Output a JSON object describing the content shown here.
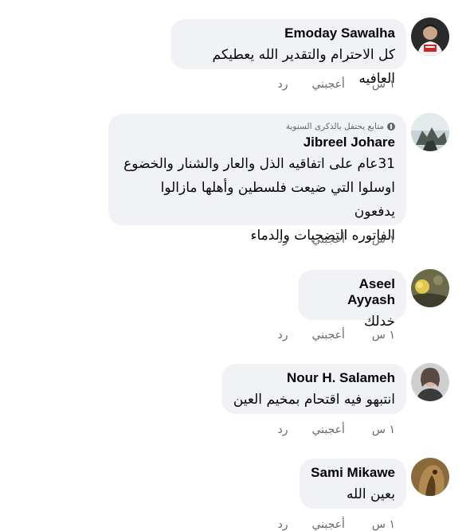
{
  "actions": {
    "time": "١ س",
    "like": "أعجبني",
    "reply": "رد"
  },
  "comments": [
    {
      "name": "Emoday Sawalha",
      "badge": "",
      "lines": [
        "كل الاحترام والتقدير الله يعطيكم العافيه"
      ]
    },
    {
      "name": "Jibreel Johare",
      "badge": "متابع يحتفل بالذكرى السنوية",
      "lines": [
        "31عام على اتفاقيه الذل والعار والشنار والخضوع",
        "اوسلوا التي ضيعت فلسطين وأهلها مازالوا يدفعون",
        "الفاتوره التضحيات والدماء"
      ]
    },
    {
      "name": "Aseel Ayyash",
      "badge": "",
      "lines": [
        "خدلك"
      ]
    },
    {
      "name": "Nour H. Salameh",
      "badge": "",
      "lines": [
        "انتبهو فيه اقتحام بمخيم العين"
      ]
    },
    {
      "name": "Sami Mikawe",
      "badge": "",
      "lines": [
        "بعين الله"
      ]
    }
  ]
}
